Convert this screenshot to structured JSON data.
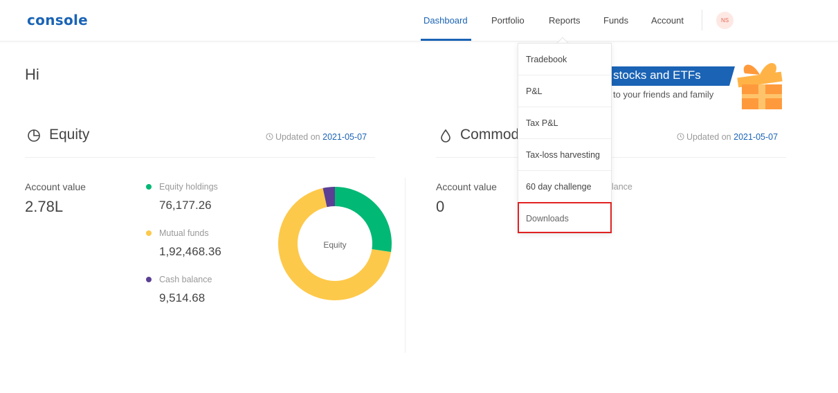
{
  "header": {
    "logo": "console",
    "nav": [
      {
        "label": "Dashboard",
        "active": true
      },
      {
        "label": "Portfolio"
      },
      {
        "label": "Reports"
      },
      {
        "label": "Funds"
      },
      {
        "label": "Account"
      }
    ],
    "avatar_initials": "NS"
  },
  "greeting": "Hi",
  "banner": {
    "title": "ft stocks and ETFs",
    "subtitle": "to your friends and family"
  },
  "equity": {
    "title": "Equity",
    "updated_prefix": "Updated on",
    "updated_date": "2021-05-07",
    "account_value_label": "Account value",
    "account_value": "2.78L",
    "legend": [
      {
        "label": "Equity holdings",
        "value": "76,177.26",
        "color": "#02b875"
      },
      {
        "label": "Mutual funds",
        "value": "1,92,468.36",
        "color": "#fdc94a"
      },
      {
        "label": "Cash balance",
        "value": "9,514.68",
        "color": "#5b3f94"
      }
    ],
    "donut_center_label": "Equity"
  },
  "commodity": {
    "title": "Commod",
    "updated_prefix": "Updated on",
    "updated_date": "2021-05-07",
    "account_value_label": "Account value",
    "account_value": "0",
    "partial_label": "lance"
  },
  "reports_menu": [
    {
      "label": "Tradebook"
    },
    {
      "label": "P&L"
    },
    {
      "label": "Tax P&L"
    },
    {
      "label": "Tax-loss harvesting"
    },
    {
      "label": "60 day challenge"
    },
    {
      "label": "Downloads"
    }
  ],
  "colors": {
    "brand": "#1a63b5",
    "highlight": "#e02020"
  },
  "chart_data": {
    "type": "pie",
    "categories": [
      "Equity holdings",
      "Mutual funds",
      "Cash balance"
    ],
    "values": [
      76177.26,
      192468.36,
      9514.68
    ],
    "title": "Equity"
  }
}
